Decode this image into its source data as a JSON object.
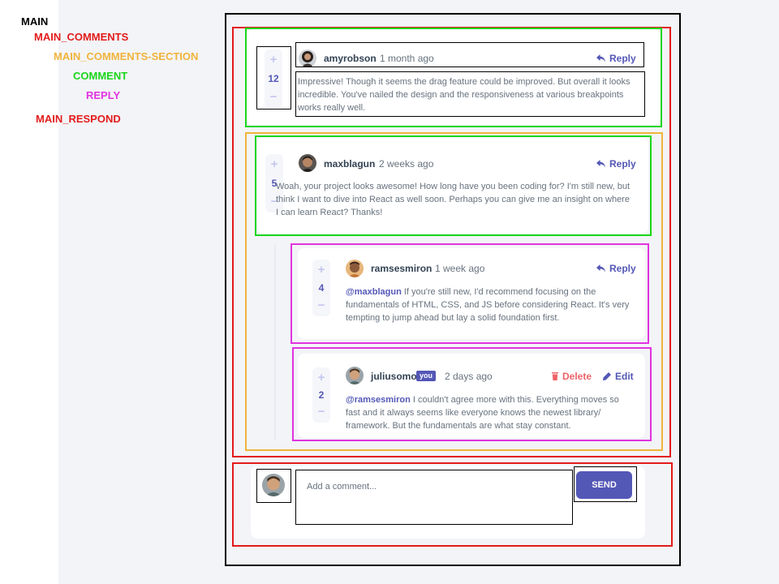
{
  "legend": {
    "main": "MAIN",
    "main_comments": "MAIN_COMMENTS",
    "comments_section": "MAIN_COMMENTS-SECTION",
    "comment": "COMMENT",
    "reply": "REPLY",
    "respond": "MAIN_RESPOND"
  },
  "colors": {
    "primary": "#5357b6",
    "danger": "#ed6368",
    "text": "#67727e",
    "heading": "#334253",
    "vote_bg": "#f5f6fa",
    "page_bg": "#f3f4f7"
  },
  "comments": [
    {
      "score": "12",
      "username": "amyrobson",
      "time": "1 month ago",
      "reply_label": "Reply",
      "text": "Impressive! Though it seems the drag feature could be improved. But overall it looks incredible. You've nailed the design and the responsiveness at various breakpoints works really well."
    },
    {
      "score": "5",
      "username": "maxblagun",
      "time": "2 weeks ago",
      "reply_label": "Reply",
      "text": "Woah, your project looks awesome! How long have you been coding for? I'm still new, but think I want to dive into React as well soon. Perhaps you can give me an insight on where I can learn React? Thanks!",
      "replies": [
        {
          "score": "4",
          "username": "ramsesmiron",
          "time": "1 week ago",
          "reply_label": "Reply",
          "mention": "@maxblagun",
          "text": "If you're still new, I'd recommend focusing on the fundamentals of HTML, CSS, and JS before considering React. It's very tempting to jump ahead but lay a solid foundation first."
        },
        {
          "score": "2",
          "username": "juliusomo",
          "you_badge": "you",
          "time": "2 days ago",
          "delete_label": "Delete",
          "edit_label": "Edit",
          "mention": "@ramsesmiron",
          "text": "I couldn't agree more with this. Everything moves so fast and it always seems like everyone knows the newest library/ framework. But the fundamentals are what stay constant."
        }
      ]
    }
  ],
  "respond": {
    "placeholder": "Add a comment...",
    "send_label": "SEND"
  },
  "icons": {
    "plus": "+",
    "minus": "−",
    "reply": "reply-arrow-icon",
    "delete": "trash-icon",
    "edit": "pencil-icon"
  }
}
